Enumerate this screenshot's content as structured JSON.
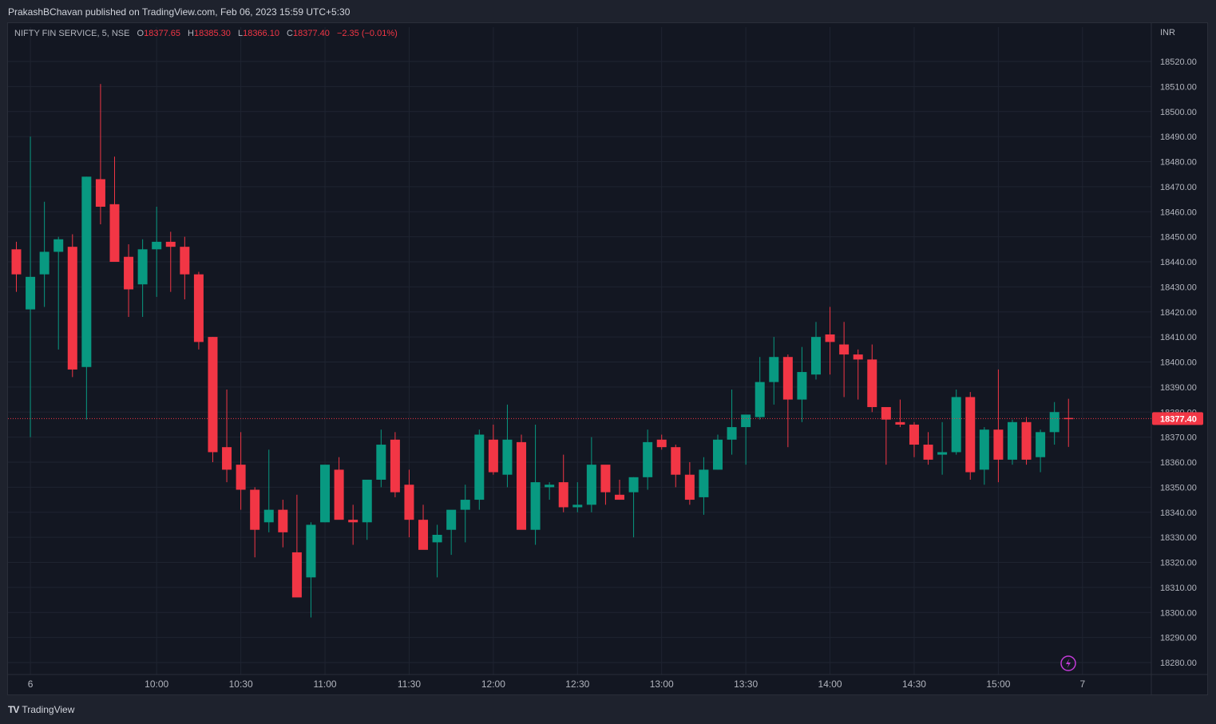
{
  "header": {
    "published": "PrakashBChavan published on TradingView.com, Feb 06, 2023 15:59 UTC+5:30"
  },
  "legend": {
    "symbol": "NIFTY FIN SERVICE, 5, NSE",
    "open_label": "O",
    "open": "18377.65",
    "high_label": "H",
    "high": "18385.30",
    "low_label": "L",
    "low": "18366.10",
    "close_label": "C",
    "close": "18377.40",
    "change": "−2.35 (−0.01%)"
  },
  "currency": "INR",
  "footer": {
    "brand": "TradingView"
  },
  "colors": {
    "up": "#089981",
    "down": "#f23645",
    "background": "#131722",
    "grid": "#1f2431",
    "text": "#b2b5be"
  },
  "chart_data": {
    "type": "candlestick",
    "ylim": [
      18272,
      18530
    ],
    "y_ticks": [
      18280,
      18290,
      18300,
      18310,
      18320,
      18330,
      18340,
      18350,
      18360,
      18370,
      18380,
      18390,
      18400,
      18410,
      18420,
      18430,
      18440,
      18450,
      18460,
      18470,
      18480,
      18490,
      18500,
      18510,
      18520
    ],
    "x_ticks": [
      "6",
      "10:00",
      "10:30",
      "11:00",
      "11:30",
      "12:00",
      "12:30",
      "13:00",
      "13:30",
      "14:00",
      "14:30",
      "15:00",
      "7"
    ],
    "last_price": "18377.40",
    "candles": [
      {
        "o": 18445,
        "h": 18448,
        "l": 18428,
        "c": 18435
      },
      {
        "o": 18421,
        "h": 18490,
        "l": 18370,
        "c": 18434
      },
      {
        "o": 18435,
        "h": 18464,
        "l": 18422,
        "c": 18444
      },
      {
        "o": 18444,
        "h": 18450,
        "l": 18405,
        "c": 18449
      },
      {
        "o": 18446,
        "h": 18451,
        "l": 18394,
        "c": 18397
      },
      {
        "o": 18398,
        "h": 18474,
        "l": 18377,
        "c": 18474
      },
      {
        "o": 18473,
        "h": 18511,
        "l": 18455,
        "c": 18462
      },
      {
        "o": 18463,
        "h": 18482,
        "l": 18440,
        "c": 18440
      },
      {
        "o": 18442,
        "h": 18447,
        "l": 18418,
        "c": 18429
      },
      {
        "o": 18431,
        "h": 18449,
        "l": 18418,
        "c": 18445
      },
      {
        "o": 18445,
        "h": 18462,
        "l": 18426,
        "c": 18448
      },
      {
        "o": 18448,
        "h": 18452,
        "l": 18428,
        "c": 18446
      },
      {
        "o": 18446,
        "h": 18450,
        "l": 18425,
        "c": 18435
      },
      {
        "o": 18435,
        "h": 18436,
        "l": 18405,
        "c": 18408
      },
      {
        "o": 18410,
        "h": 18410,
        "l": 18360,
        "c": 18364
      },
      {
        "o": 18366,
        "h": 18389,
        "l": 18352,
        "c": 18357
      },
      {
        "o": 18359,
        "h": 18372,
        "l": 18341,
        "c": 18349
      },
      {
        "o": 18349,
        "h": 18350,
        "l": 18322,
        "c": 18333
      },
      {
        "o": 18336,
        "h": 18365,
        "l": 18332,
        "c": 18341
      },
      {
        "o": 18341,
        "h": 18345,
        "l": 18326,
        "c": 18332
      },
      {
        "o": 18324,
        "h": 18347,
        "l": 18310,
        "c": 18306
      },
      {
        "o": 18314,
        "h": 18336,
        "l": 18298,
        "c": 18335
      },
      {
        "o": 18336,
        "h": 18359,
        "l": 18336,
        "c": 18359
      },
      {
        "o": 18357,
        "h": 18362,
        "l": 18338,
        "c": 18337
      },
      {
        "o": 18337,
        "h": 18343,
        "l": 18327,
        "c": 18336
      },
      {
        "o": 18336,
        "h": 18351,
        "l": 18329,
        "c": 18353
      },
      {
        "o": 18353,
        "h": 18373,
        "l": 18350,
        "c": 18367
      },
      {
        "o": 18369,
        "h": 18372,
        "l": 18346,
        "c": 18348
      },
      {
        "o": 18351,
        "h": 18357,
        "l": 18330,
        "c": 18337
      },
      {
        "o": 18337,
        "h": 18343,
        "l": 18326,
        "c": 18325
      },
      {
        "o": 18328,
        "h": 18335,
        "l": 18314,
        "c": 18331
      },
      {
        "o": 18333,
        "h": 18340,
        "l": 18323,
        "c": 18341
      },
      {
        "o": 18341,
        "h": 18351,
        "l": 18328,
        "c": 18345
      },
      {
        "o": 18345,
        "h": 18373,
        "l": 18341,
        "c": 18371
      },
      {
        "o": 18369,
        "h": 18375,
        "l": 18355,
        "c": 18356
      },
      {
        "o": 18355,
        "h": 18383,
        "l": 18350,
        "c": 18369
      },
      {
        "o": 18368,
        "h": 18371,
        "l": 18352,
        "c": 18333
      },
      {
        "o": 18333,
        "h": 18375,
        "l": 18327,
        "c": 18352
      },
      {
        "o": 18350,
        "h": 18352,
        "l": 18345,
        "c": 18351
      },
      {
        "o": 18352,
        "h": 18363,
        "l": 18340,
        "c": 18342
      },
      {
        "o": 18342,
        "h": 18352,
        "l": 18340,
        "c": 18343
      },
      {
        "o": 18343,
        "h": 18370,
        "l": 18340,
        "c": 18359
      },
      {
        "o": 18359,
        "h": 18358,
        "l": 18343,
        "c": 18348
      },
      {
        "o": 18347,
        "h": 18353,
        "l": 18345,
        "c": 18345
      },
      {
        "o": 18348,
        "h": 18354,
        "l": 18330,
        "c": 18354
      },
      {
        "o": 18354,
        "h": 18373,
        "l": 18349,
        "c": 18368
      },
      {
        "o": 18369,
        "h": 18371,
        "l": 18365,
        "c": 18366
      },
      {
        "o": 18366,
        "h": 18367,
        "l": 18350,
        "c": 18355
      },
      {
        "o": 18355,
        "h": 18360,
        "l": 18343,
        "c": 18345
      },
      {
        "o": 18346,
        "h": 18362,
        "l": 18339,
        "c": 18357
      },
      {
        "o": 18357,
        "h": 18371,
        "l": 18357,
        "c": 18369
      },
      {
        "o": 18369,
        "h": 18389,
        "l": 18363,
        "c": 18374
      },
      {
        "o": 18374,
        "h": 18378,
        "l": 18359,
        "c": 18379
      },
      {
        "o": 18378,
        "h": 18402,
        "l": 18377,
        "c": 18392
      },
      {
        "o": 18392,
        "h": 18410,
        "l": 18383,
        "c": 18402
      },
      {
        "o": 18402,
        "h": 18403,
        "l": 18366,
        "c": 18385
      },
      {
        "o": 18385,
        "h": 18406,
        "l": 18376,
        "c": 18396
      },
      {
        "o": 18395,
        "h": 18416,
        "l": 18393,
        "c": 18410
      },
      {
        "o": 18411,
        "h": 18422,
        "l": 18395,
        "c": 18408
      },
      {
        "o": 18407,
        "h": 18416,
        "l": 18386,
        "c": 18403
      },
      {
        "o": 18403,
        "h": 18405,
        "l": 18385,
        "c": 18401
      },
      {
        "o": 18401,
        "h": 18407,
        "l": 18380,
        "c": 18382
      },
      {
        "o": 18382,
        "h": 18382,
        "l": 18359,
        "c": 18377
      },
      {
        "o": 18376,
        "h": 18385,
        "l": 18374,
        "c": 18375
      },
      {
        "o": 18375,
        "h": 18376,
        "l": 18362,
        "c": 18367
      },
      {
        "o": 18367,
        "h": 18372,
        "l": 18359,
        "c": 18361
      },
      {
        "o": 18363,
        "h": 18376,
        "l": 18355,
        "c": 18364
      },
      {
        "o": 18364,
        "h": 18389,
        "l": 18363,
        "c": 18386
      },
      {
        "o": 18386,
        "h": 18388,
        "l": 18353,
        "c": 18356
      },
      {
        "o": 18357,
        "h": 18374,
        "l": 18351,
        "c": 18373
      },
      {
        "o": 18373,
        "h": 18397,
        "l": 18352,
        "c": 18361
      },
      {
        "o": 18361,
        "h": 18377,
        "l": 18359,
        "c": 18376
      },
      {
        "o": 18376,
        "h": 18378,
        "l": 18359,
        "c": 18361
      },
      {
        "o": 18362,
        "h": 18373,
        "l": 18356,
        "c": 18372
      },
      {
        "o": 18372,
        "h": 18384,
        "l": 18367,
        "c": 18380
      },
      {
        "o": 18377.65,
        "h": 18385.3,
        "l": 18366.1,
        "c": 18377.4
      }
    ]
  }
}
